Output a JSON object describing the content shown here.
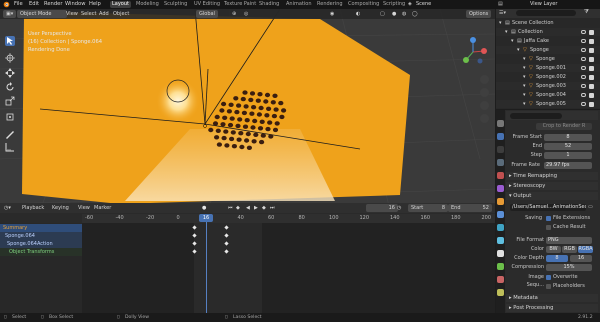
{
  "topbar": {
    "menus": [
      "File",
      "Edit",
      "Render",
      "Window",
      "Help"
    ],
    "workspaces": [
      "Layout",
      "Modeling",
      "Sculpting",
      "UV Editing",
      "Texture Paint",
      "Shading",
      "Animation",
      "Rendering",
      "Compositing",
      "Scripting"
    ],
    "active_workspace": "Layout",
    "scene": "Scene",
    "view_layer": "View Layer"
  },
  "viewport_header": {
    "mode": "Object Mode",
    "menus": [
      "View",
      "Select",
      "Add",
      "Object"
    ],
    "orientation": "Global",
    "options": "Options"
  },
  "viewport_info": {
    "line1": "User Perspective",
    "line2": "(16) Collection | Sponge.064",
    "line3": "Rendering Done"
  },
  "outliner": {
    "rows": [
      {
        "label": "Scene Collection",
        "indent": 0
      },
      {
        "label": "Collection",
        "indent": 1
      },
      {
        "label": "Jaffa Cake",
        "indent": 2
      },
      {
        "label": "Sponge",
        "indent": 3
      },
      {
        "label": "Sponge",
        "indent": 4
      },
      {
        "label": "Sponge.001",
        "indent": 4
      },
      {
        "label": "Sponge.002",
        "indent": 4
      },
      {
        "label": "Sponge.003",
        "indent": 4
      },
      {
        "label": "Sponge.004",
        "indent": 4
      },
      {
        "label": "Sponge.005",
        "indent": 4
      }
    ]
  },
  "properties": {
    "crop_label": "Crop to Render R",
    "frame_start_label": "Frame Start",
    "frame_start": "8",
    "end_label": "End",
    "end": "52",
    "step_label": "Step",
    "step": "1",
    "frame_rate_label": "Frame Rate",
    "frame_rate": "29.97 fps",
    "time_remapping": "Time Remapping",
    "stereoscopy": "Stereoscopy",
    "output": "Output",
    "output_path": "/Users/Samuel...AnimationSecond",
    "saving_label": "Saving",
    "file_extensions": "File Extensions",
    "cache_result": "Cache Result",
    "file_format_label": "File Format",
    "file_format": "PNG",
    "color_label": "Color",
    "color_options": [
      "BW",
      "RGB",
      "RGBA"
    ],
    "color_active": "RGBA",
    "color_depth_label": "Color Depth",
    "color_depth_options": [
      "8",
      "16"
    ],
    "compression_label": "Compression",
    "compression": "15%",
    "image_sequence_label": "Image Sequ...",
    "overwrite": "Overwrite",
    "placeholders": "Placeholders",
    "metadata": "Metadata",
    "post_processing": "Post Processing",
    "version": "2.91.2"
  },
  "timeline": {
    "menus": [
      "Playback",
      "Keying",
      "View",
      "Marker"
    ],
    "current_frame": "16",
    "start_label": "Start",
    "start": "8",
    "end_label": "End",
    "end": "52",
    "ruler_ticks": [
      "-60",
      "-40",
      "-20",
      "0",
      "20",
      "40",
      "60",
      "80",
      "100",
      "120",
      "140",
      "160",
      "180",
      "200"
    ],
    "current_marker": "16",
    "channels": [
      "Summary",
      "Sponge.064",
      "Sponge.064Action",
      "Object Transforms"
    ],
    "keyframe_frames": [
      0,
      16
    ]
  },
  "statusbar": {
    "items": [
      "Select",
      "Box Select",
      "Dolly View",
      "Lasso Select"
    ],
    "version": "2.91.2"
  },
  "colors": {
    "accent": "#4772b3",
    "orange_plane": "#f0a51c",
    "active_tab": "#3d3d3d"
  }
}
